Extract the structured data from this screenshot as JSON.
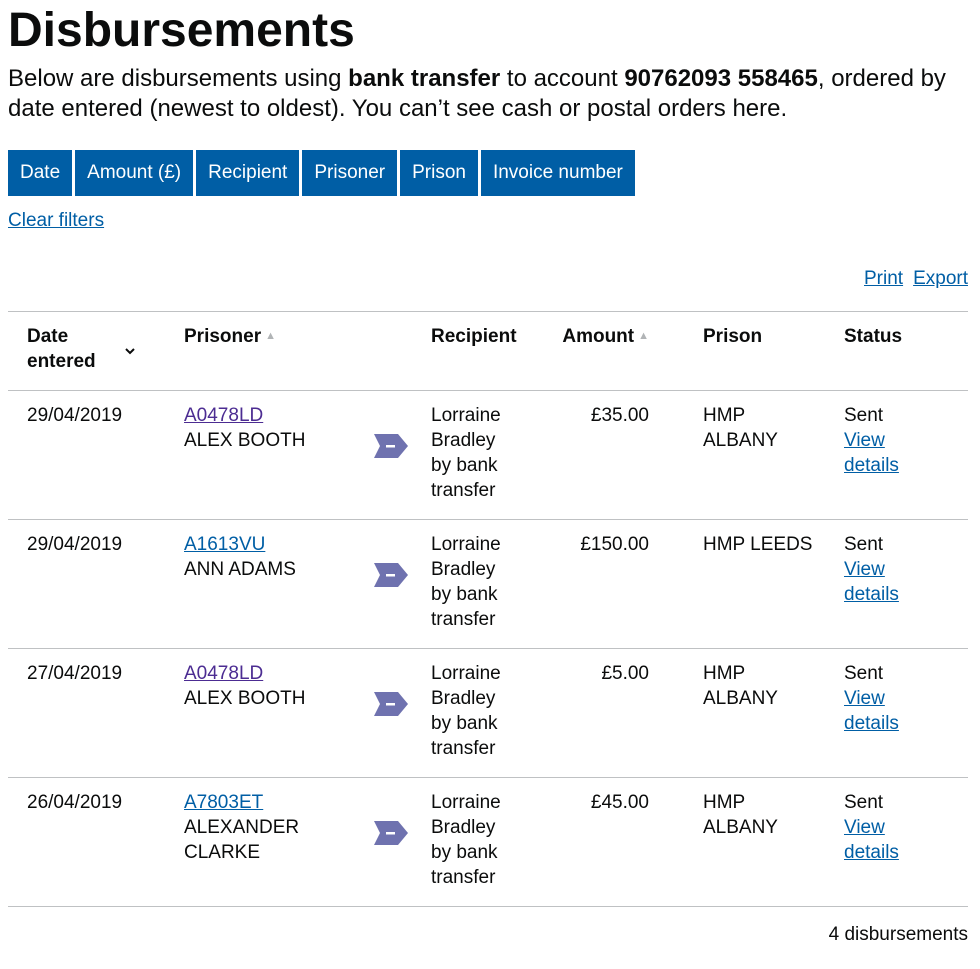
{
  "page": {
    "title": "Disbursements",
    "lede_part1": "Below are disbursements using ",
    "lede_bold1": "bank transfer",
    "lede_part2": " to account ",
    "lede_bold2": "90762093 558465",
    "lede_part3": ", ordered by date entered (newest to oldest). You can’t see cash or postal orders here."
  },
  "filters": [
    {
      "label": "Date"
    },
    {
      "label": "Amount (£)"
    },
    {
      "label": "Recipient"
    },
    {
      "label": "Prisoner"
    },
    {
      "label": "Prison"
    },
    {
      "label": "Invoice number"
    }
  ],
  "clear_filters": "Clear filters",
  "actions": {
    "print": "Print",
    "export": "Export"
  },
  "table": {
    "headers": {
      "date_line1": "Date",
      "date_line2": "entered",
      "prisoner": "Prisoner",
      "recipient": "Recipient",
      "amount": "Amount",
      "prison": "Prison",
      "status": "Status"
    },
    "rows": [
      {
        "date": "29/04/2019",
        "prisoner_number": "A0478LD",
        "prisoner_name": "ALEX BOOTH",
        "recipient": "Lorraine Bradley by bank transfer",
        "amount": "£35.00",
        "prison": "HMP ALBANY",
        "status": "Sent",
        "link": "View details"
      },
      {
        "date": "29/04/2019",
        "prisoner_number": "A1613VU",
        "prisoner_name": "ANN ADAMS",
        "recipient": "Lorraine Bradley by bank transfer",
        "amount": "£150.00",
        "prison": "HMP LEEDS",
        "status": "Sent",
        "link": "View details"
      },
      {
        "date": "27/04/2019",
        "prisoner_number": "A0478LD",
        "prisoner_name": "ALEX BOOTH",
        "recipient": "Lorraine Bradley by bank transfer",
        "amount": "£5.00",
        "prison": "HMP ALBANY",
        "status": "Sent",
        "link": "View details"
      },
      {
        "date": "26/04/2019",
        "prisoner_number": "A7803ET",
        "prisoner_name": "ALEXANDER CLARKE",
        "recipient": "Lorraine Bradley by bank transfer",
        "amount": "£45.00",
        "prison": "HMP ALBANY",
        "status": "Sent",
        "link": "View details"
      }
    ]
  },
  "footer": {
    "count": "4 disbursements"
  },
  "colors": {
    "button_blue": "#005ea5",
    "link_blue": "#005ea5",
    "visited_purple": "#4c2c92",
    "arrow_purple": "#6f72af",
    "border_grey": "#bfc1c3"
  },
  "icons": {
    "transfer_arrow": "arrow-tag-icon",
    "sort_down": "chevron-down-icon",
    "sort_up": "caret-up-icon"
  }
}
